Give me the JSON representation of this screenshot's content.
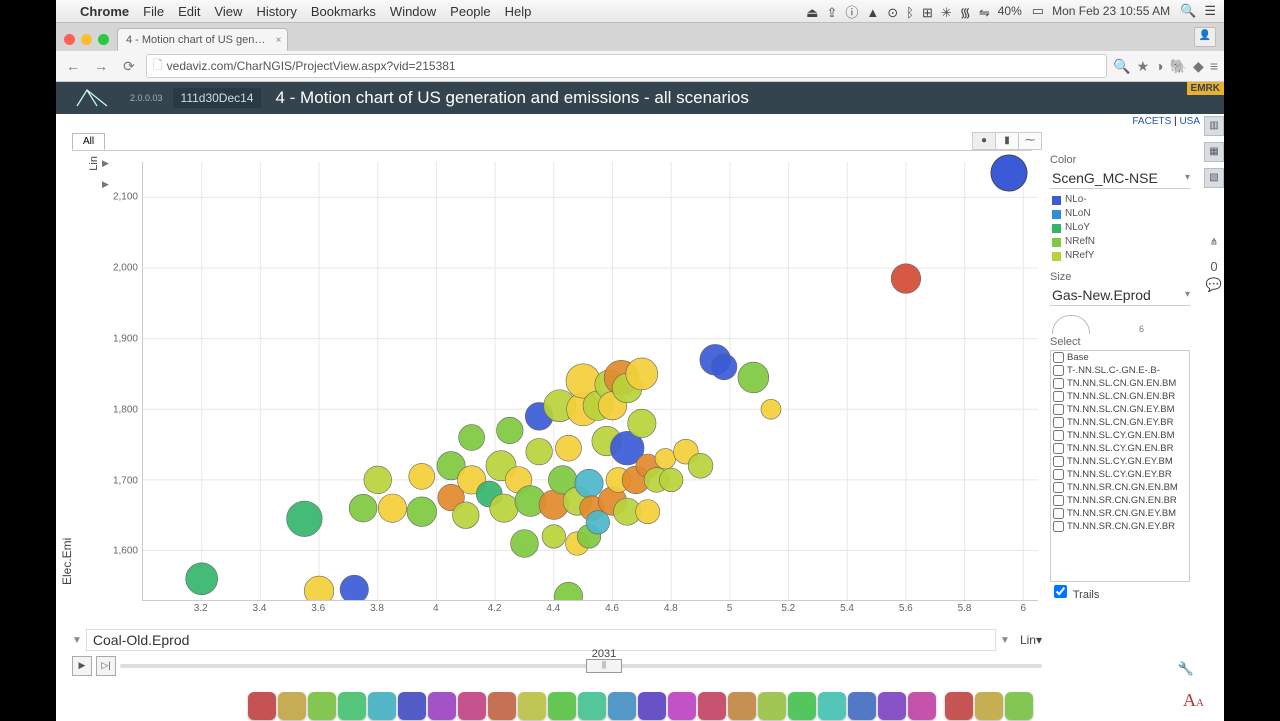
{
  "os": {
    "app": "Chrome",
    "menus": [
      "File",
      "Edit",
      "View",
      "History",
      "Bookmarks",
      "Window",
      "People",
      "Help"
    ],
    "status_icons": [
      "⏏",
      "⇪",
      "ⓘ",
      "▲",
      "⊙",
      "ᛒ",
      "⊞",
      "✳",
      "᯾",
      "⇋"
    ],
    "wifi": "40%",
    "battery_icon": "▭",
    "clock": "Mon Feb 23  10:55 AM",
    "right_icons": [
      "🔍",
      "☰"
    ]
  },
  "browser": {
    "tab_title": "4 - Motion chart of US gen…",
    "url": "vedaviz.com/CharNGIS/ProjectView.aspx?vid=215381",
    "emrk": "EMRK"
  },
  "header": {
    "version": "2.0.0.03",
    "badge": "111d30Dec14",
    "title": "4 - Motion chart of US generation and emissions - all scenarios",
    "crumbs": [
      "FACETS",
      "USA"
    ]
  },
  "chart": {
    "tab": "All",
    "y_label": "Elec.Emi",
    "y_scale": "Lin",
    "x_label": "Coal-Old.Eprod",
    "x_scale": "Lin",
    "year": "2031",
    "tools": [
      "●",
      "▮",
      "⁓"
    ]
  },
  "panel": {
    "color_label": "Color",
    "color_value": "ScenG_MC-NSE",
    "legend": [
      {
        "name": "NLo-",
        "c": "#3b5bd6"
      },
      {
        "name": "NLoN",
        "c": "#2f8fd6"
      },
      {
        "name": "NLoY",
        "c": "#34b56a"
      },
      {
        "name": "NRefN",
        "c": "#7ec93e"
      },
      {
        "name": "NRefY",
        "c": "#b8d23a"
      }
    ],
    "size_label": "Size",
    "size_value": "Gas-New.Eprod",
    "size_max": "6",
    "select_label": "Select",
    "select_items": [
      "Base",
      "T-.NN.SL.C-.GN.E-.B-",
      "TN.NN.SL.CN.GN.EN.BM",
      "TN.NN.SL.CN.GN.EN.BR",
      "TN.NN.SL.CN.GN.EY.BM",
      "TN.NN.SL.CN.GN.EY.BR",
      "TN.NN.SL.CY.GN.EN.BM",
      "TN.NN.SL.CY.GN.EN.BR",
      "TN.NN.SL.CY.GN.EY.BM",
      "TN.NN.SL.CY.GN.EY.BR",
      "TN.NN.SR.CN.GN.EN.BM",
      "TN.NN.SR.CN.GN.EN.BR",
      "TN.NN.SR.CN.GN.EY.BM",
      "TN.NN.SR.CN.GN.EY.BR"
    ],
    "trails_label": "Trails"
  },
  "chart_data": {
    "type": "scatter",
    "title": "Motion chart of US generation and emissions - all scenarios",
    "xlabel": "Coal-Old.Eprod",
    "ylabel": "Elec.Emi",
    "xlim": [
      3.0,
      6.05
    ],
    "ylim": [
      1530,
      2150
    ],
    "xticks": [
      3.2,
      3.4,
      3.6,
      3.8,
      4,
      4.2,
      4.4,
      4.6,
      4.8,
      5,
      5.2,
      5.4,
      5.6,
      5.8,
      6
    ],
    "yticks": [
      1600,
      1700,
      1800,
      1900,
      2000,
      2100
    ],
    "size_var": "Gas-New.Eprod",
    "size_max": 6,
    "year": 2031,
    "colors": {
      "NLo-": "#3b5bd6",
      "NLoN": "#2f8fd6",
      "NLoY": "#34b56a",
      "NRefN": "#7ec93e",
      "NRefY": "#b8d23a",
      "orange": "#e28a2b",
      "red": "#d34b34",
      "yellow": "#f3cf3a",
      "teal": "#4bb7c9"
    },
    "points": [
      {
        "x": 3.2,
        "y": 1560,
        "s": 4.0,
        "c": "#34b56a"
      },
      {
        "x": 3.6,
        "y": 1543,
        "s": 3.6,
        "c": "#f3cf3a"
      },
      {
        "x": 3.72,
        "y": 1545,
        "s": 3.4,
        "c": "#3b5bd6"
      },
      {
        "x": 3.55,
        "y": 1645,
        "s": 4.6,
        "c": "#34b56a"
      },
      {
        "x": 3.75,
        "y": 1660,
        "s": 3.3,
        "c": "#7ec93e"
      },
      {
        "x": 3.8,
        "y": 1700,
        "s": 3.3,
        "c": "#b8d23a"
      },
      {
        "x": 3.85,
        "y": 1660,
        "s": 3.4,
        "c": "#f3cf3a"
      },
      {
        "x": 3.95,
        "y": 1655,
        "s": 3.6,
        "c": "#7ec93e"
      },
      {
        "x": 3.95,
        "y": 1705,
        "s": 3.0,
        "c": "#f3cf3a"
      },
      {
        "x": 4.05,
        "y": 1675,
        "s": 3.1,
        "c": "#e28a2b"
      },
      {
        "x": 4.05,
        "y": 1720,
        "s": 3.4,
        "c": "#7ec93e"
      },
      {
        "x": 4.1,
        "y": 1650,
        "s": 3.1,
        "c": "#b8d23a"
      },
      {
        "x": 4.12,
        "y": 1700,
        "s": 3.4,
        "c": "#f3cf3a"
      },
      {
        "x": 4.12,
        "y": 1760,
        "s": 3.0,
        "c": "#7ec93e"
      },
      {
        "x": 4.18,
        "y": 1680,
        "s": 3.0,
        "c": "#34b56a"
      },
      {
        "x": 4.22,
        "y": 1720,
        "s": 3.7,
        "c": "#b8d23a"
      },
      {
        "x": 4.23,
        "y": 1660,
        "s": 3.4,
        "c": "#b8d23a"
      },
      {
        "x": 4.25,
        "y": 1770,
        "s": 3.1,
        "c": "#7ec93e"
      },
      {
        "x": 4.28,
        "y": 1700,
        "s": 3.1,
        "c": "#f3cf3a"
      },
      {
        "x": 4.3,
        "y": 1610,
        "s": 3.3,
        "c": "#7ec93e"
      },
      {
        "x": 4.32,
        "y": 1670,
        "s": 3.8,
        "c": "#7ec93e"
      },
      {
        "x": 4.35,
        "y": 1740,
        "s": 3.1,
        "c": "#b8d23a"
      },
      {
        "x": 4.35,
        "y": 1790,
        "s": 3.3,
        "c": "#3b5bd6"
      },
      {
        "x": 4.4,
        "y": 1620,
        "s": 2.6,
        "c": "#b8d23a"
      },
      {
        "x": 4.4,
        "y": 1665,
        "s": 3.6,
        "c": "#e28a2b"
      },
      {
        "x": 4.42,
        "y": 1805,
        "s": 4.0,
        "c": "#b8d23a"
      },
      {
        "x": 4.43,
        "y": 1700,
        "s": 3.4,
        "c": "#7ec93e"
      },
      {
        "x": 4.45,
        "y": 1535,
        "s": 3.4,
        "c": "#7ec93e"
      },
      {
        "x": 4.45,
        "y": 1745,
        "s": 3.0,
        "c": "#f3cf3a"
      },
      {
        "x": 4.48,
        "y": 1610,
        "s": 2.6,
        "c": "#f3cf3a"
      },
      {
        "x": 4.48,
        "y": 1670,
        "s": 3.4,
        "c": "#b8d23a"
      },
      {
        "x": 4.5,
        "y": 1800,
        "s": 4.2,
        "c": "#f3cf3a"
      },
      {
        "x": 4.5,
        "y": 1840,
        "s": 4.4,
        "c": "#f3cf3a"
      },
      {
        "x": 4.52,
        "y": 1620,
        "s": 2.6,
        "c": "#7ec93e"
      },
      {
        "x": 4.52,
        "y": 1695,
        "s": 3.4,
        "c": "#4bb7c9"
      },
      {
        "x": 4.53,
        "y": 1660,
        "s": 2.8,
        "c": "#e28a2b"
      },
      {
        "x": 4.55,
        "y": 1640,
        "s": 2.6,
        "c": "#4bb7c9"
      },
      {
        "x": 4.55,
        "y": 1805,
        "s": 3.6,
        "c": "#b8d23a"
      },
      {
        "x": 4.58,
        "y": 1755,
        "s": 3.6,
        "c": "#b8d23a"
      },
      {
        "x": 4.59,
        "y": 1835,
        "s": 3.6,
        "c": "#b8d23a"
      },
      {
        "x": 4.6,
        "y": 1670,
        "s": 3.4,
        "c": "#e28a2b"
      },
      {
        "x": 4.6,
        "y": 1805,
        "s": 3.4,
        "c": "#f3cf3a"
      },
      {
        "x": 4.62,
        "y": 1700,
        "s": 2.8,
        "c": "#f3cf3a"
      },
      {
        "x": 4.63,
        "y": 1845,
        "s": 4.4,
        "c": "#e28a2b"
      },
      {
        "x": 4.65,
        "y": 1655,
        "s": 3.2,
        "c": "#b8d23a"
      },
      {
        "x": 4.65,
        "y": 1745,
        "s": 4.3,
        "c": "#3b5bd6"
      },
      {
        "x": 4.65,
        "y": 1830,
        "s": 3.6,
        "c": "#b8d23a"
      },
      {
        "x": 4.68,
        "y": 1700,
        "s": 3.3,
        "c": "#e28a2b"
      },
      {
        "x": 4.7,
        "y": 1780,
        "s": 3.4,
        "c": "#b8d23a"
      },
      {
        "x": 4.7,
        "y": 1850,
        "s": 4.0,
        "c": "#f3cf3a"
      },
      {
        "x": 4.72,
        "y": 1655,
        "s": 2.7,
        "c": "#f3cf3a"
      },
      {
        "x": 4.72,
        "y": 1720,
        "s": 2.6,
        "c": "#e28a2b"
      },
      {
        "x": 4.75,
        "y": 1700,
        "s": 2.8,
        "c": "#b8d23a"
      },
      {
        "x": 4.78,
        "y": 1730,
        "s": 2.1,
        "c": "#f3cf3a"
      },
      {
        "x": 4.8,
        "y": 1700,
        "s": 2.6,
        "c": "#b8d23a"
      },
      {
        "x": 4.85,
        "y": 1740,
        "s": 2.8,
        "c": "#f3cf3a"
      },
      {
        "x": 4.9,
        "y": 1720,
        "s": 2.8,
        "c": "#b8d23a"
      },
      {
        "x": 4.95,
        "y": 1870,
        "s": 3.8,
        "c": "#3b5bd6"
      },
      {
        "x": 4.98,
        "y": 1860,
        "s": 3.0,
        "c": "#3b5bd6"
      },
      {
        "x": 5.08,
        "y": 1845,
        "s": 3.8,
        "c": "#7ec93e"
      },
      {
        "x": 5.14,
        "y": 1800,
        "s": 2.0,
        "c": "#f3cf3a"
      },
      {
        "x": 5.6,
        "y": 1985,
        "s": 3.6,
        "c": "#d34b34"
      }
    ],
    "outlier_blue": {
      "x": 5.95,
      "y": 2135,
      "s": 5.0,
      "c": "#3b5bd6"
    }
  }
}
